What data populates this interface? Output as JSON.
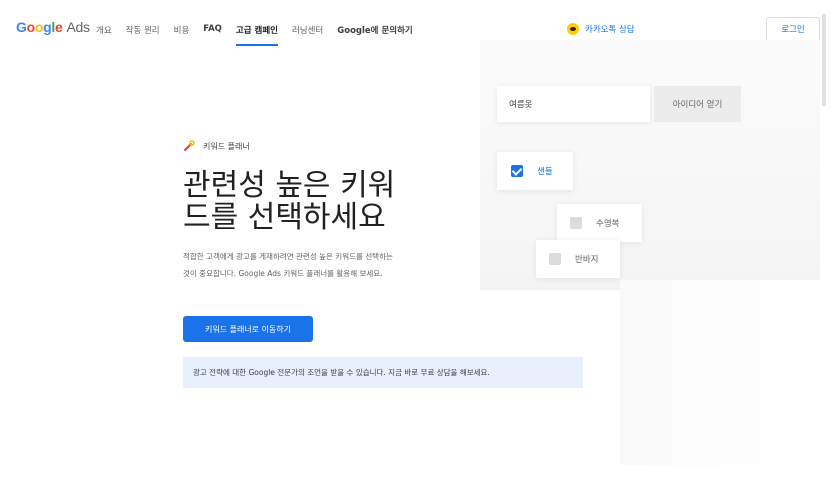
{
  "nav": {
    "logo": {
      "google": "Google",
      "ads": "Ads"
    },
    "items": [
      {
        "label": "개요"
      },
      {
        "label": "작동 원리"
      },
      {
        "label": "비용"
      },
      {
        "label": "FAQ"
      },
      {
        "label": "고급 캠페인"
      },
      {
        "label": "러닝센터"
      },
      {
        "label": "Google에 문의하기"
      }
    ],
    "active_item": "고급 캠페인",
    "kakao_label": "카카오톡 상담",
    "login_label": "로그인"
  },
  "hero": {
    "eyebrow": "키워드 플래너",
    "headline": "관련성 높은 키워드를 선택하세요",
    "description": "적합한 고객에게 광고를 게재하려면 관련성 높은 키워드를 선택하는 것이 중요합니다. Google Ads 키워드 플래너를 활용해 보세요.",
    "cta_label": "키워드 플래너로 이동하기",
    "notice": "광고 전략에 대한 Google 전문가의 조언을 받을 수 있습니다. 지금 바로 무료 상담을 해보세요."
  },
  "illustration": {
    "search_value": "여름옷",
    "idea_button": "아이디어 얻기",
    "keywords": [
      {
        "label": "샌들",
        "checked": true
      },
      {
        "label": "수영복",
        "checked": false
      },
      {
        "label": "반바지",
        "checked": false
      }
    ]
  },
  "colors": {
    "accent": "#1a73e8",
    "kakao": "#ffcd00",
    "notice_bg": "#e8f0fe"
  }
}
